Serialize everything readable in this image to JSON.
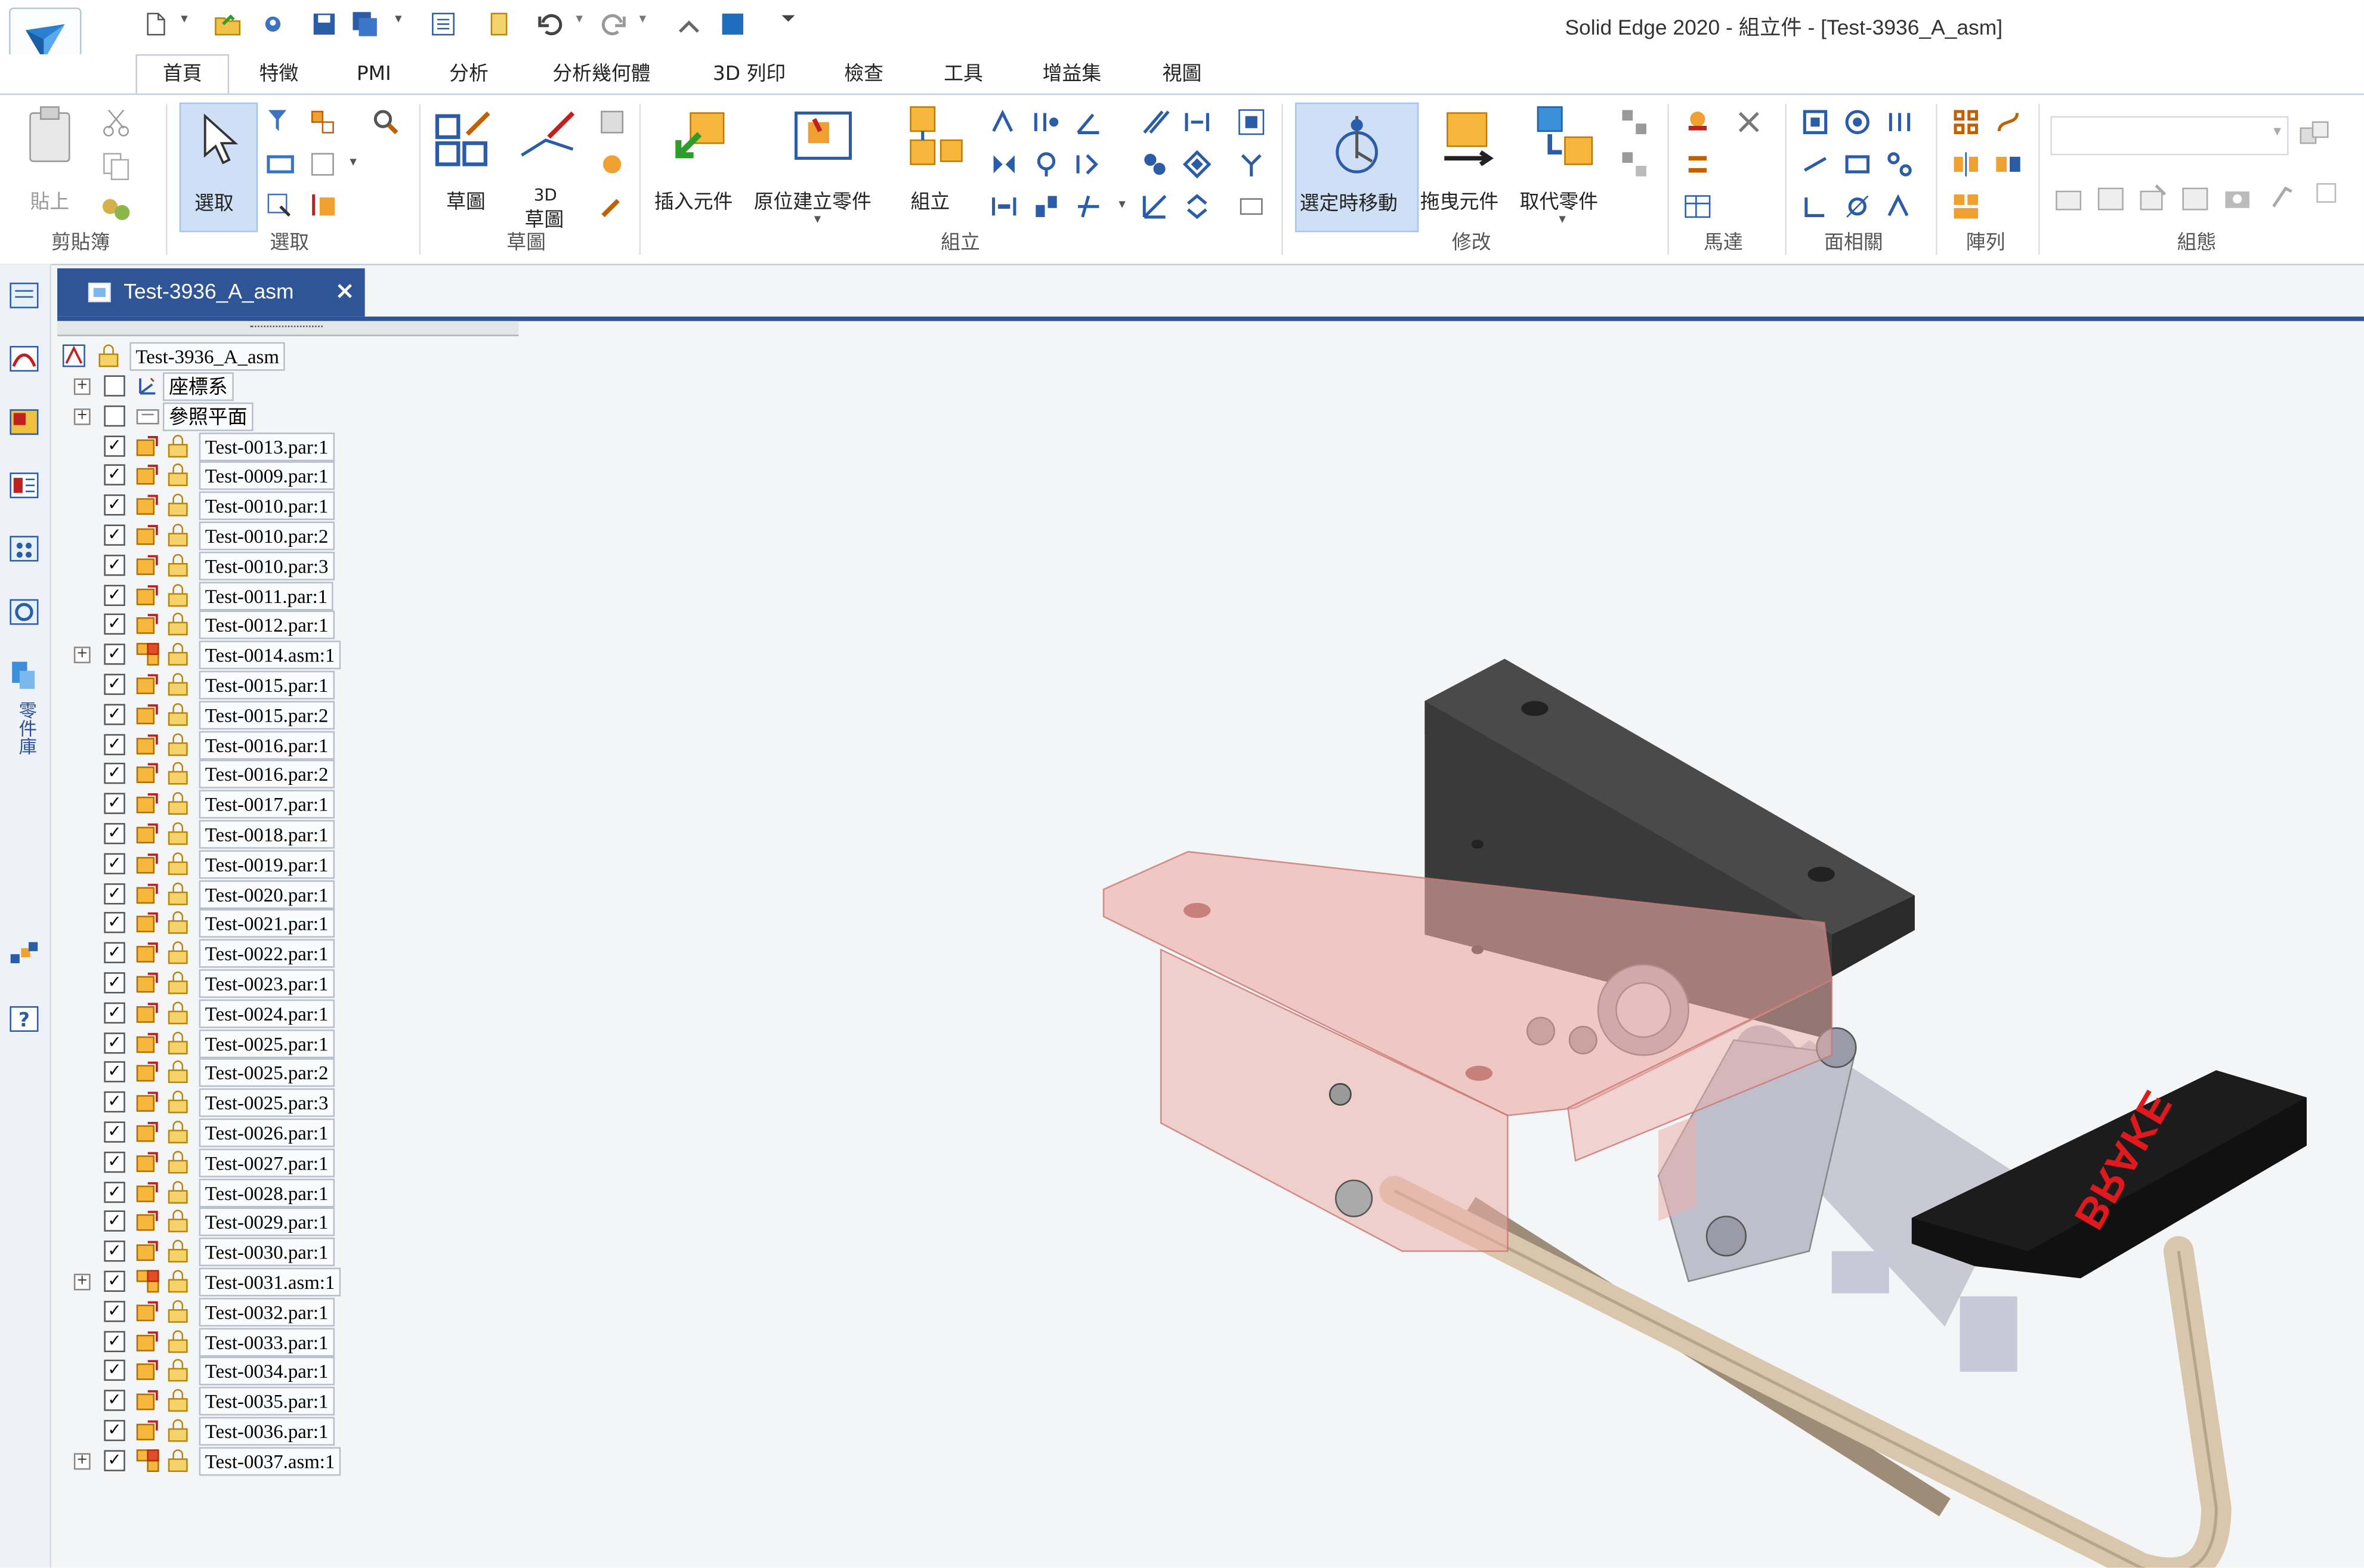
{
  "window": {
    "title": "Solid Edge 2020 - 組立件 - [Test-3936_A_asm]"
  },
  "tabs": [
    "首頁",
    "特徵",
    "PMI",
    "分析",
    "分析幾何體",
    "3D 列印",
    "檢查",
    "工具",
    "增益集",
    "視圖"
  ],
  "ribbon": {
    "clipboard": {
      "paste": "貼上",
      "group": "剪貼簿"
    },
    "select": {
      "select": "選取",
      "group": "選取"
    },
    "sketch": {
      "sketch": "草圖",
      "sketch3d_a": "3D",
      "sketch3d_b": "草圖",
      "group": "草圖"
    },
    "assemble": {
      "insert": "插入元件",
      "create_in_place": "原位建立零件",
      "assemble": "組立",
      "group": "組立"
    },
    "modify": {
      "move_on_select": "選定時移動",
      "drag": "拖曳元件",
      "replace": "取代零件",
      "group": "修改"
    },
    "motor": {
      "group": "馬達"
    },
    "face_rel": {
      "group": "面相關"
    },
    "pattern": {
      "group": "陣列"
    },
    "config": {
      "group": "組態"
    }
  },
  "leftbar": {
    "parts_library": "零件庫"
  },
  "doc_tab": {
    "label": "Test-3936_A_asm",
    "close": "×"
  },
  "tree": {
    "root": "Test-3936_A_asm",
    "items": [
      {
        "label": "座標系",
        "expandable": true,
        "checked": false,
        "kind": "cs"
      },
      {
        "label": "參照平面",
        "expandable": true,
        "checked": false,
        "kind": "plane"
      },
      {
        "label": "Test-0013.par:1",
        "expandable": false,
        "checked": true,
        "kind": "par"
      },
      {
        "label": "Test-0009.par:1",
        "expandable": false,
        "checked": true,
        "kind": "par"
      },
      {
        "label": "Test-0010.par:1",
        "expandable": false,
        "checked": true,
        "kind": "par"
      },
      {
        "label": "Test-0010.par:2",
        "expandable": false,
        "checked": true,
        "kind": "par"
      },
      {
        "label": "Test-0010.par:3",
        "expandable": false,
        "checked": true,
        "kind": "par"
      },
      {
        "label": "Test-0011.par:1",
        "expandable": false,
        "checked": true,
        "kind": "par"
      },
      {
        "label": "Test-0012.par:1",
        "expandable": false,
        "checked": true,
        "kind": "par"
      },
      {
        "label": "Test-0014.asm:1",
        "expandable": true,
        "checked": true,
        "kind": "asm"
      },
      {
        "label": "Test-0015.par:1",
        "expandable": false,
        "checked": true,
        "kind": "par"
      },
      {
        "label": "Test-0015.par:2",
        "expandable": false,
        "checked": true,
        "kind": "par"
      },
      {
        "label": "Test-0016.par:1",
        "expandable": false,
        "checked": true,
        "kind": "par"
      },
      {
        "label": "Test-0016.par:2",
        "expandable": false,
        "checked": true,
        "kind": "par"
      },
      {
        "label": "Test-0017.par:1",
        "expandable": false,
        "checked": true,
        "kind": "par"
      },
      {
        "label": "Test-0018.par:1",
        "expandable": false,
        "checked": true,
        "kind": "par"
      },
      {
        "label": "Test-0019.par:1",
        "expandable": false,
        "checked": true,
        "kind": "par"
      },
      {
        "label": "Test-0020.par:1",
        "expandable": false,
        "checked": true,
        "kind": "par"
      },
      {
        "label": "Test-0021.par:1",
        "expandable": false,
        "checked": true,
        "kind": "par"
      },
      {
        "label": "Test-0022.par:1",
        "expandable": false,
        "checked": true,
        "kind": "par"
      },
      {
        "label": "Test-0023.par:1",
        "expandable": false,
        "checked": true,
        "kind": "par"
      },
      {
        "label": "Test-0024.par:1",
        "expandable": false,
        "checked": true,
        "kind": "par"
      },
      {
        "label": "Test-0025.par:1",
        "expandable": false,
        "checked": true,
        "kind": "par"
      },
      {
        "label": "Test-0025.par:2",
        "expandable": false,
        "checked": true,
        "kind": "par"
      },
      {
        "label": "Test-0025.par:3",
        "expandable": false,
        "checked": true,
        "kind": "par"
      },
      {
        "label": "Test-0026.par:1",
        "expandable": false,
        "checked": true,
        "kind": "par"
      },
      {
        "label": "Test-0027.par:1",
        "expandable": false,
        "checked": true,
        "kind": "par"
      },
      {
        "label": "Test-0028.par:1",
        "expandable": false,
        "checked": true,
        "kind": "par"
      },
      {
        "label": "Test-0029.par:1",
        "expandable": false,
        "checked": true,
        "kind": "par"
      },
      {
        "label": "Test-0030.par:1",
        "expandable": false,
        "checked": true,
        "kind": "par"
      },
      {
        "label": "Test-0031.asm:1",
        "expandable": true,
        "checked": true,
        "kind": "asm"
      },
      {
        "label": "Test-0032.par:1",
        "expandable": false,
        "checked": true,
        "kind": "par"
      },
      {
        "label": "Test-0033.par:1",
        "expandable": false,
        "checked": true,
        "kind": "par"
      },
      {
        "label": "Test-0034.par:1",
        "expandable": false,
        "checked": true,
        "kind": "par"
      },
      {
        "label": "Test-0035.par:1",
        "expandable": false,
        "checked": true,
        "kind": "par"
      },
      {
        "label": "Test-0036.par:1",
        "expandable": false,
        "checked": true,
        "kind": "par"
      },
      {
        "label": "Test-0037.asm:1",
        "expandable": true,
        "checked": true,
        "kind": "asm"
      }
    ]
  },
  "model": {
    "pedal_text": "BRAKE",
    "pedal_text_color": "#e0191e"
  },
  "colors": {
    "accent": "#2f5597",
    "selected": "#cfe0f6"
  }
}
